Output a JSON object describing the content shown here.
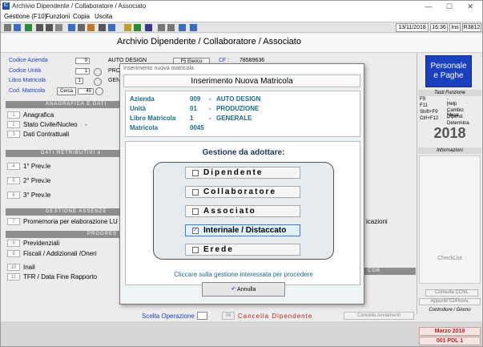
{
  "window": {
    "title": "Archivio Dipendente / Collaboratore / Associato",
    "app_icon": "IC",
    "minimize": "—",
    "maximize": "☐",
    "close": "✕"
  },
  "menu": [
    "Gestione (F10)",
    "Funzioni",
    "Copia",
    "Uscita"
  ],
  "toolbar": {
    "date": "13/11/2018",
    "time": "16:36",
    "ins": "Ins",
    "code": "R3812"
  },
  "page_title": "Archivio Dipendente / Collaboratore / Associato",
  "left_fields": [
    {
      "label": "Codice Azienda",
      "value": "9",
      "text": "AUTO DESIGN"
    },
    {
      "label": "Codice Unità",
      "value": "1",
      "text": "PRO"
    },
    {
      "label": "Libro Matricola",
      "value": "1",
      "text": "GEN"
    },
    {
      "label": "Cod. Matricola",
      "value": "45",
      "button": "Cerca"
    }
  ],
  "header_extra": {
    "button": "F5 Elenco",
    "cf_label": "CF :",
    "cf_value": "78589636"
  },
  "sections": {
    "anagrafica": "ANAGRAFICA E DATI",
    "retributivi": "DATI RETRIBUTIVI e",
    "assenze": "GESTIONE ASSENZE INPS/",
    "progressivi": "PROGRES",
    "right_cob": "COB"
  },
  "rows": [
    {
      "num": "1",
      "label": "Anagrafica"
    },
    {
      "num": "2",
      "label": "Stato Civile/Nucleo",
      "extra": "-"
    },
    {
      "num": "3",
      "label": "Dati Contrattuali"
    },
    {
      "num": "4",
      "label": "1° Prev.le"
    },
    {
      "num": "5",
      "label": "2° Prev.le"
    },
    {
      "num": "6",
      "label": "3° Prev.le"
    },
    {
      "num": "7",
      "label": "Promemoria per elaborazione LU",
      "tail": "icazioni"
    },
    {
      "num": "8",
      "label": "Previdenziali"
    },
    {
      "num": "9",
      "label": "Fiscali / Addizionali /Oneri"
    },
    {
      "num": "10",
      "label": "Inail"
    },
    {
      "num": "11",
      "label": "TFR / Data Fine Rapporto"
    }
  ],
  "footer": {
    "scelta": "Scelta Operazione",
    "op_num": "99",
    "cancella": "Cancella Dipendente",
    "cancella_avv": "Cancella Avviamenti"
  },
  "right_panel": {
    "logo_line1": "Personale",
    "logo_line2": "e Paghe",
    "tasti_head": "Tasti Funzione",
    "keys": [
      {
        "k": "F9",
        "v": "- Help"
      },
      {
        "k": "F11",
        "v": "- Cambio Mese"
      },
      {
        "k": "Shift+F9",
        "v": "- Dipend."
      },
      {
        "k": "Ctrl+F12",
        "v": "- Determina"
      }
    ],
    "year": "2018",
    "info_head": "Informazioni",
    "checklist": "CheckList",
    "consulta": "Consulta CCNL",
    "appunti": "Appunti/TD/Provv.",
    "controllore": "Controllore / Giorno",
    "month": "Marzo 2018",
    "pdl": "001 PDL 1"
  },
  "modal": {
    "title": "Inserimento nuova matricola",
    "heading": "Inserimento Nuova Matricola",
    "info": [
      {
        "k": "Azienda",
        "code": "009",
        "v": "AUTO DESIGN"
      },
      {
        "k": "Unità",
        "code": "01",
        "v": "PRODUZIONE"
      },
      {
        "k": "Libro Matricola",
        "code": "1",
        "v": "GENERALE"
      },
      {
        "k": "Matricola",
        "code": "0045",
        "v": ""
      }
    ],
    "gestione_title": "Gestione da adottare:",
    "options": [
      {
        "label": "Dipendente",
        "checked": false
      },
      {
        "label": "Collaboratore",
        "checked": false
      },
      {
        "label": "Associato",
        "checked": false
      },
      {
        "label": "Interinale / Distaccato",
        "checked": true
      },
      {
        "label": "Erede",
        "checked": false
      }
    ],
    "hint": "Cliccare sulla gestione interessata per procedere",
    "annulla": "Annulla"
  }
}
